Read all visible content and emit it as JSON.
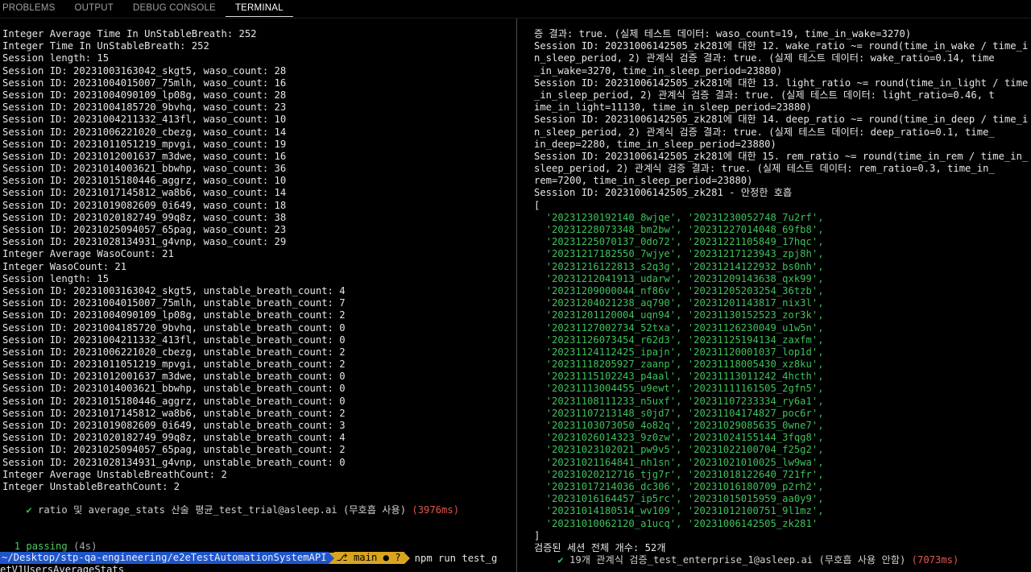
{
  "tabs": [
    "PROBLEMS",
    "OUTPUT",
    "DEBUG CONSOLE",
    "TERMINAL"
  ],
  "left": {
    "lines": [
      "Integer Average Time In UnStableBreath: 252",
      "Integer Time In UnStableBreath: 252",
      "Session length: 15",
      "Session ID: 20231003163042_skgt5, waso_count: 28",
      "Session ID: 20231004015007_75mlh, waso_count: 16",
      "Session ID: 20231004090109_lp08g, waso_count: 28",
      "Session ID: 20231004185720_9bvhq, waso_count: 23",
      "Session ID: 20231004211332_413fl, waso_count: 10",
      "Session ID: 20231006221020_cbezg, waso_count: 14",
      "Session ID: 20231011051219_mpvgi, waso_count: 19",
      "Session ID: 20231012001637_m3dwe, waso_count: 16",
      "Session ID: 20231014003621_bbwhp, waso_count: 36",
      "Session ID: 20231015180446_aggrz, waso_count: 10",
      "Session ID: 20231017145812_wa8b6, waso_count: 14",
      "Session ID: 20231019082609_0i649, waso_count: 18",
      "Session ID: 20231020182749_99q8z, waso_count: 38",
      "Session ID: 20231025094057_65pag, waso_count: 23",
      "Session ID: 20231028134931_g4vnp, waso_count: 29",
      "Integer Average WasoCount: 21",
      "Integer WasoCount: 21",
      "Session length: 15",
      "Session ID: 20231003163042_skgt5, unstable_breath_count: 4",
      "Session ID: 20231004015007_75mlh, unstable_breath_count: 7",
      "Session ID: 20231004090109_lp08g, unstable_breath_count: 2",
      "Session ID: 20231004185720_9bvhq, unstable_breath_count: 0",
      "Session ID: 20231004211332_413fl, unstable_breath_count: 0",
      "Session ID: 20231006221020_cbezg, unstable_breath_count: 2",
      "Session ID: 20231011051219_mpvgi, unstable_breath_count: 2",
      "Session ID: 20231012001637_m3dwe, unstable_breath_count: 0",
      "Session ID: 20231014003621_bbwhp, unstable_breath_count: 0",
      "Session ID: 20231015180446_aggrz, unstable_breath_count: 0",
      "Session ID: 20231017145812_wa8b6, unstable_breath_count: 2",
      "Session ID: 20231019082609_0i649, unstable_breath_count: 3",
      "Session ID: 20231020182749_99q8z, unstable_breath_count: 4",
      "Session ID: 20231025094057_65pag, unstable_breath_count: 2",
      "Session ID: 20231028134931_g4vnp, unstable_breath_count: 0",
      "Integer Average UnstableBreathCount: 2",
      "Integer UnstableBreathCount: 2"
    ],
    "test_check": "✔",
    "test_name": " ratio 및 average_stats 산술 평균_test_trial@asleep.ai (무호흡 사용) ",
    "test_time": "(3976ms)",
    "passing": "1 passing",
    "passing_time": " (4s)",
    "prompt_path": "~/Desktop/stp-qa-engineering/e2eTestAutomationSystemAPI",
    "prompt_branch": " main ● ?",
    "prompt_cmd": "npm run test_g",
    "prompt_wrap": "etV1UsersAverageStats"
  },
  "right": {
    "lines_top": [
      "증 결과: true. (실제 테스트 데이터: waso_count=19, time_in_wake=3270)",
      "Session ID: 20231006142505_zk281에 대한 12. wake_ratio ~= round(time_in_wake / time_i",
      "n_sleep_period, 2) 관계식 검증 결과: true. (실제 테스트 데이터: wake_ratio=0.14, time",
      "_in_wake=3270, time_in_sleep_period=23880)",
      "Session ID: 20231006142505_zk281에 대한 13. light_ratio ~= round(time_in_light / time",
      "_in_sleep_period, 2) 관계식 검증 결과: true. (실제 테스트 데이터: light_ratio=0.46, t",
      "ime_in_light=11130, time_in_sleep_period=23880)",
      "Session ID: 20231006142505_zk281에 대한 14. deep_ratio ~= round(time_in_deep / time_i",
      "n_sleep_period, 2) 관계식 검증 결과: true. (실제 테스트 데이터: deep_ratio=0.1, time_",
      "in_deep=2280, time_in_sleep_period=23880)",
      "Session ID: 20231006142505_zk281에 대한 15. rem_ratio ~= round(time_in_rem / time_in_",
      "rem=7200, time_in_sleep_period=23880)",
      "Session ID: 20231006142505_zk281 - 안정한 호흡",
      "["
    ],
    "rem_line_extra": "sleep_period, 2) 관계식 검증 결과: true. (실제 테스트 데이터: rem_ratio=0.3, time_in_",
    "array_lines": [
      "  '20231230192140_8wjqe', '20231230052748_7u2rf',",
      "  '20231228073348_bm2bw', '20231227014048_69fb8',",
      "  '20231225070137_0do72', '20231221105849_17hqc',",
      "  '20231217182550_7wjye', '20231217123943_zpj8h',",
      "  '20231216122813_s2q3g', '20231214122932_bs0nh',",
      "  '20231212041913_udarw', '20231209143638_qxk99',",
      "  '20231209000044_nf86v', '20231205203254_36tzb',",
      "  '20231204021238_aq790', '20231201143817_nix3l',",
      "  '20231201120004_uqn94', '20231130152523_zor3k',",
      "  '20231127002734_52txa', '20231126230049_u1w5n',",
      "  '20231126073454_r62d3', '20231125194134_zaxfm',",
      "  '20231124112425_ipajn', '20231120001037_lop1d',",
      "  '20231118205927_zaanp', '20231118005430_xz8ku',",
      "  '20231115102243_p4aal', '20231113011242_4hcth',",
      "  '20231113004455_u9ewt', '20231111161505_2gfn5',",
      "  '20231108111233_n5uxf', '20231107233334_ry6a1',",
      "  '20231107213148_s0jd7', '20231104174827_poc6r',",
      "  '20231103073050_4o82q', '20231029085635_0wne7',",
      "  '20231026014323_9z0zw', '20231024155144_3fqg8',",
      "  '20231023102021_pw9v5', '20231022100704_f25g2',",
      "  '20231021164841_nh1sn', '20231021010025_lw9wa',",
      "  '20231020212716_tjg7r', '20231018122640_721fr',",
      "  '20231017214036_dc306', '20231016180709_p2rh2',",
      "  '20231016164457_ip5rc', '20231015015959_aa0y9',",
      "  '20231014180514_wv109', '20231012100751_9l1mz',",
      "  '20231010062120_a1ucq', '20231006142505_zk281'"
    ],
    "array_close": "]",
    "total": "검증된 세션 전체 개수: 52개",
    "test_check": "✔",
    "test_name": " 19개 관계식 검증_test_enterprise_1@asleep.ai (무호흡 사용 안함) ",
    "test_time": "(7073ms)"
  },
  "colors": {
    "green": "#3fc15b",
    "red": "#e0574f",
    "path_bg": "#1f55c9",
    "git_bg": "#d9a520"
  }
}
